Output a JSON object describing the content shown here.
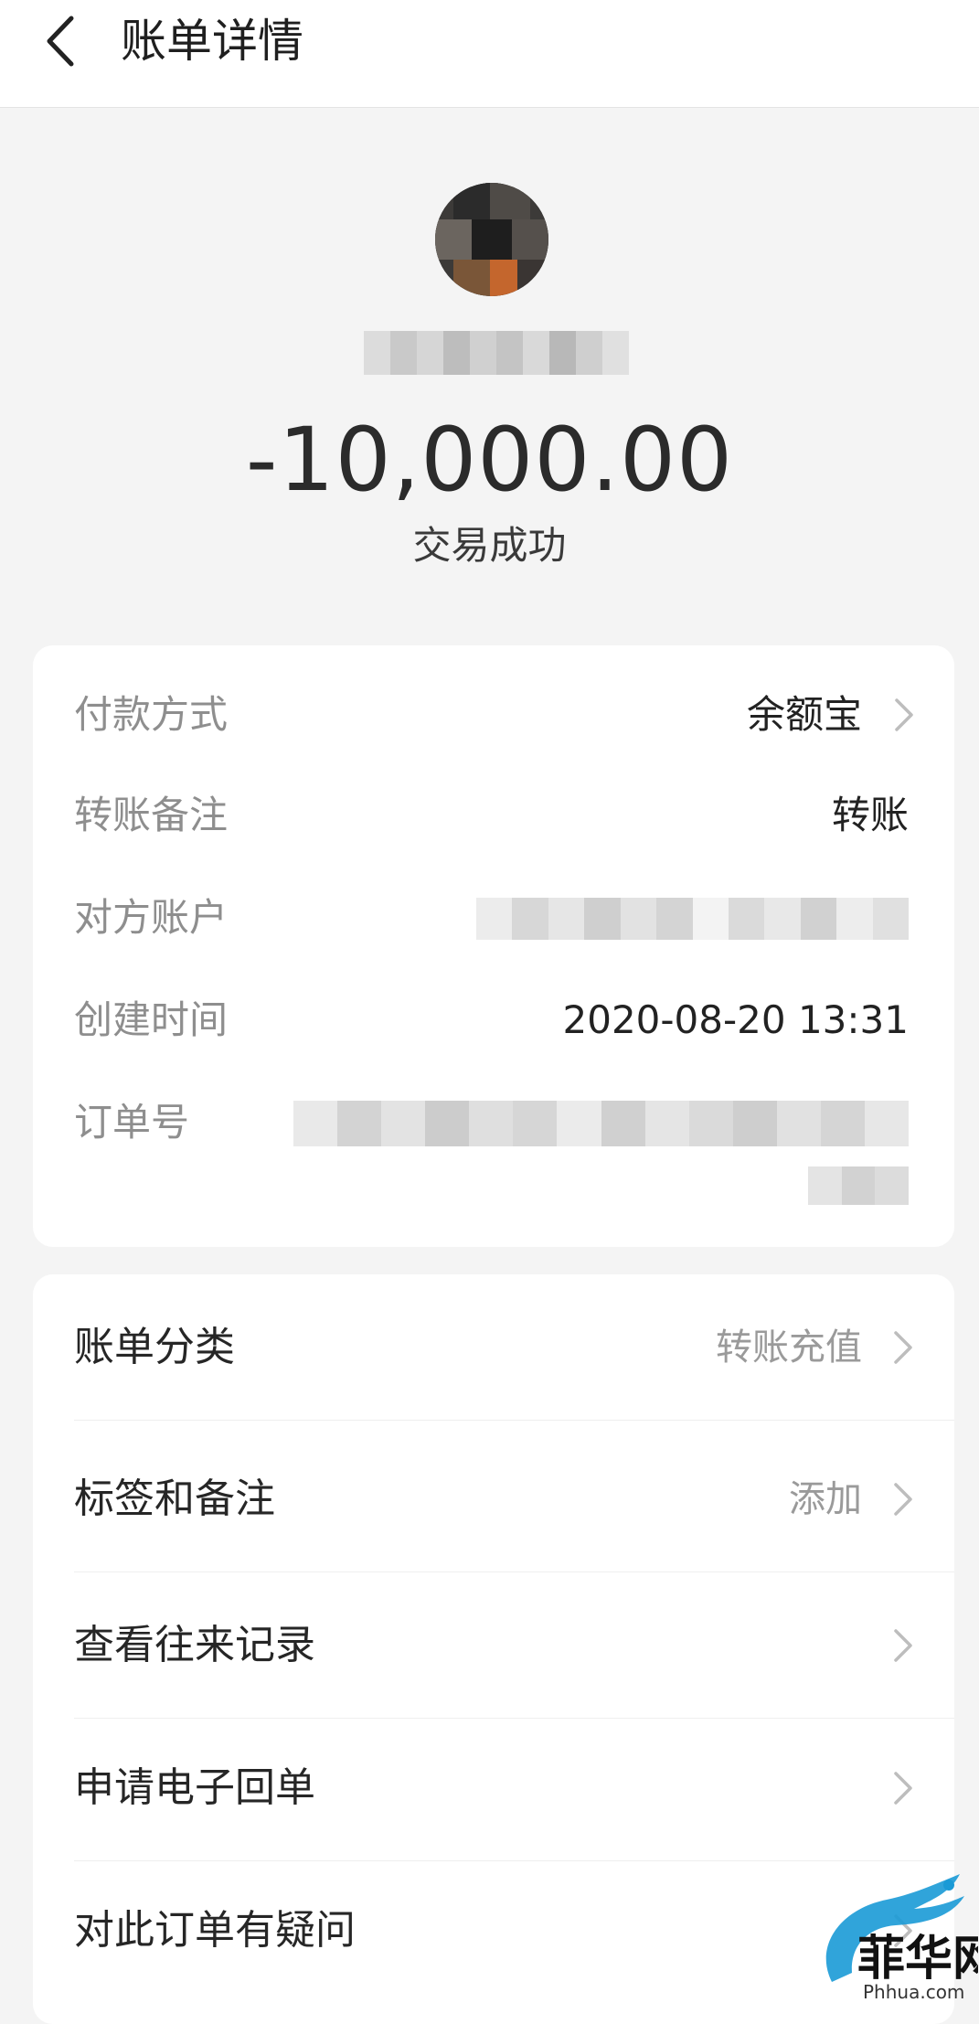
{
  "header": {
    "title": "账单详情",
    "back_icon": "chevron-left-icon"
  },
  "summary": {
    "amount": "-10,000.00",
    "status": "交易成功"
  },
  "details": {
    "payment_method": {
      "label": "付款方式",
      "value": "余额宝"
    },
    "transfer_note": {
      "label": "转账备注",
      "value": "转账"
    },
    "counterparty": {
      "label": "对方账户"
    },
    "created_time": {
      "label": "创建时间",
      "value": "2020-08-20 13:31"
    },
    "order_number": {
      "label": "订单号"
    }
  },
  "menu": {
    "category": {
      "label": "账单分类",
      "value": "转账充值"
    },
    "tags": {
      "label": "标签和备注",
      "value": "添加"
    },
    "history": {
      "label": "查看往来记录"
    },
    "e_receipt": {
      "label": "申请电子回单"
    },
    "question": {
      "label": "对此订单有疑问"
    }
  },
  "watermark": {
    "text": "菲华网",
    "subtext": "Phhua.com",
    "color": "#1a9ad6"
  },
  "colors": {
    "background": "#f4f4f4",
    "card": "#ffffff",
    "label_gray": "#8e8e8e",
    "text_dark": "#222222"
  }
}
